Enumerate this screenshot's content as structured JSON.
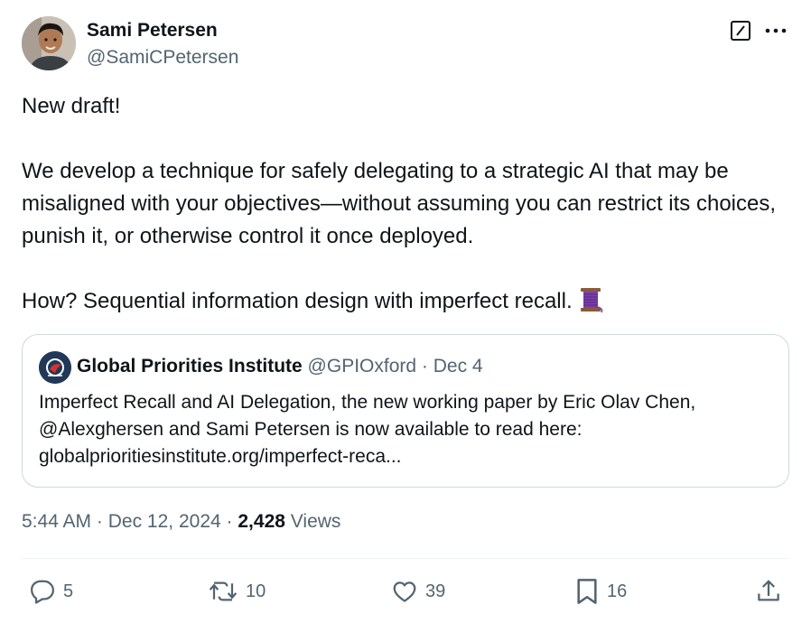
{
  "author": {
    "name": "Sami Petersen",
    "handle": "@SamiCPetersen"
  },
  "tweet": {
    "line1": "New draft!",
    "line2": "We develop a technique for safely delegating to a strategic AI that may be misaligned with your objectives—without assuming you can restrict its choices, punish it, or otherwise control it once deployed.",
    "line3": "How? Sequential information design with imperfect recall."
  },
  "quote": {
    "name": "Global Priorities Institute",
    "handle": "@GPIOxford",
    "separator": "·",
    "date": "Dec 4",
    "text": "Imperfect Recall and AI Delegation, the new working paper by Eric Olav Chen, @Alexghersen and Sami Petersen is now available to read here: globalprioritiesinstitute.org/imperfect-reca..."
  },
  "meta": {
    "time": "5:44 AM",
    "sep1": "·",
    "date": "Dec 12, 2024",
    "sep2": "·",
    "views_count": "2,428",
    "views_label": "Views"
  },
  "actions": {
    "replies": "5",
    "reposts": "10",
    "likes": "39",
    "bookmarks": "16"
  },
  "icons": {
    "grok": "grok-icon",
    "more": "more-icon",
    "reply": "reply-icon",
    "repost": "repost-icon",
    "like": "like-icon",
    "bookmark": "bookmark-icon",
    "share": "share-icon",
    "emoji": "thread-spool-emoji"
  },
  "colors": {
    "text": "#0f1419",
    "secondary": "#536471",
    "border": "#cfd9de"
  }
}
